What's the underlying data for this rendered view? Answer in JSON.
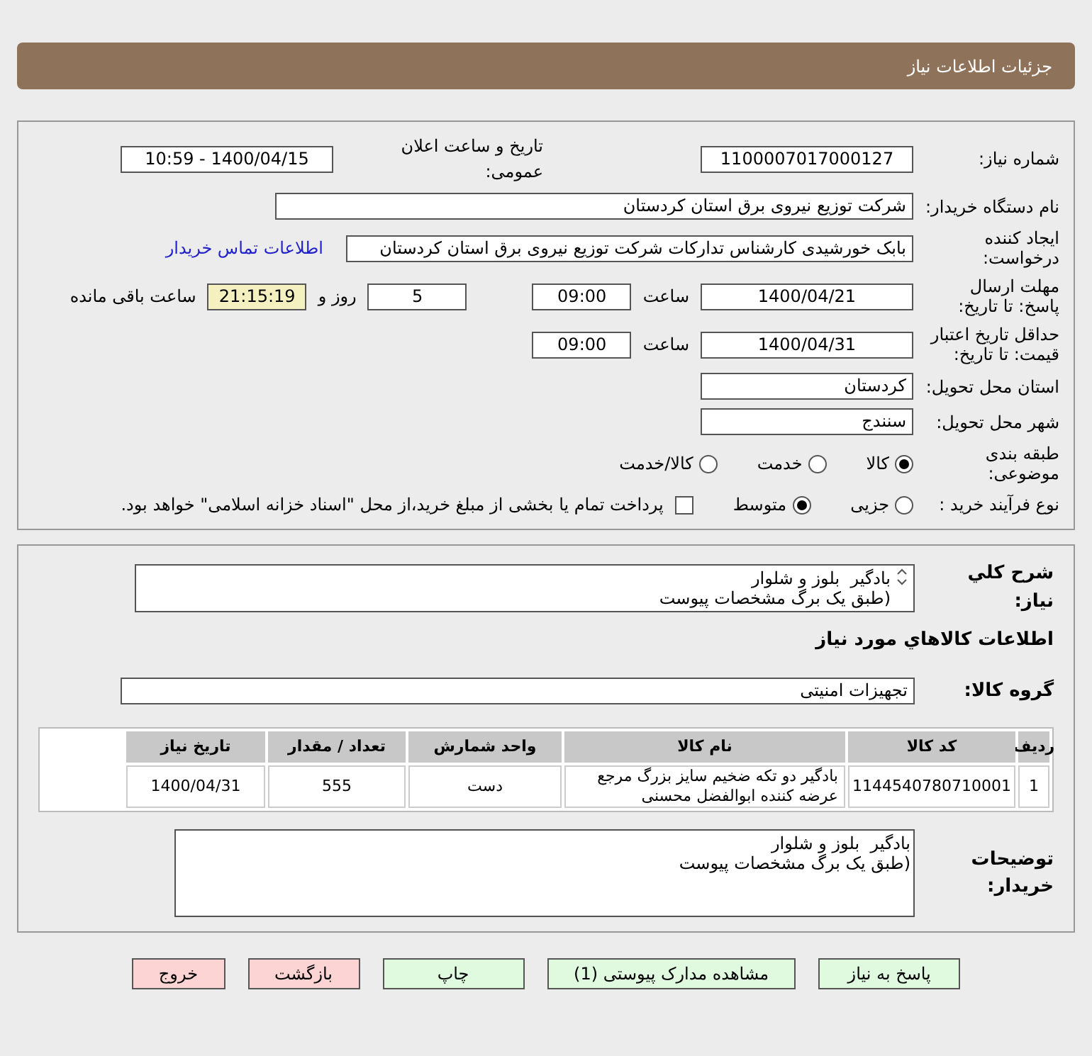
{
  "header": {
    "title": "جزئیات اطلاعات نیاز"
  },
  "need_number": {
    "label": "شماره نیاز:",
    "value": "1100007017000127"
  },
  "announce": {
    "label": "تاریخ و ساعت اعلان عمومی:",
    "value": "1400/04/15 - 10:59"
  },
  "buyer": {
    "label": "نام دستگاه خریدار:",
    "value": "شرکت توزیع نیروی برق استان کردستان"
  },
  "creator": {
    "label": "ایجاد کننده درخواست:",
    "value": "بابک خورشیدی کارشناس تدارکات شرکت توزیع نیروی برق استان کردستان",
    "link": "اطلاعات تماس خریدار"
  },
  "deadline": {
    "label": "مهلت ارسال پاسخ: تا تاریخ:",
    "date": "1400/04/21",
    "time_label": "ساعت",
    "time": "09:00",
    "days": "5",
    "days_label": "روز و",
    "countdown": "21:15:19",
    "remaining_label": "ساعت باقی مانده"
  },
  "validity": {
    "label": "حداقل تاریخ اعتبار قیمت: تا تاریخ:",
    "date": "1400/04/31",
    "time_label": "ساعت",
    "time": "09:00"
  },
  "province": {
    "label": "استان محل تحویل:",
    "value": "کردستان"
  },
  "city": {
    "label": "شهر محل تحویل:",
    "value": "سنندج"
  },
  "category": {
    "label": "طبقه بندی موضوعی:",
    "options": [
      {
        "label": "کالا",
        "selected": true
      },
      {
        "label": "خدمت",
        "selected": false
      },
      {
        "label": "کالا/خدمت",
        "selected": false
      }
    ]
  },
  "purchase_type": {
    "label": "نوع فرآیند خرید :",
    "options": [
      {
        "label": "جزیی",
        "selected": false
      },
      {
        "label": "متوسط",
        "selected": true
      }
    ],
    "payment": {
      "label": "پرداخت تمام یا بخشی از مبلغ خرید،از محل \"اسناد خزانه اسلامی\" خواهد بود.",
      "checked": false
    }
  },
  "description": {
    "label": "شرح کلي نياز:",
    "lines": [
      "بادگیر  بلوز و شلوار",
      "(طبق یک برگ مشخصات پیوست"
    ]
  },
  "goods_heading": "اطلاعات کالاهاي مورد نياز",
  "goods_group": {
    "label": "گروه کالا:",
    "value": "تجهیزات امنیتی"
  },
  "table": {
    "columns": [
      "ردیف",
      "کد کالا",
      "نام کالا",
      "واحد شمارش",
      "تعداد / مقدار",
      "تاریخ نیاز"
    ],
    "rows": [
      [
        "1",
        "1144540780710001",
        "بادگیر دو تکه ضخیم سایز بزرگ مرجع عرضه کننده ابوالفضل محسنی",
        "دست",
        "555",
        "1400/04/31"
      ]
    ]
  },
  "buyer_notes": {
    "label": "توضیحات خریدار:",
    "lines": [
      "بادگیر  بلوز و شلوار",
      "(طبق یک برگ مشخصات پیوست"
    ]
  },
  "buttons": [
    {
      "label": "پاسخ به نیاز",
      "kind": "normal"
    },
    {
      "label": "مشاهده مدارک پیوستی (1)",
      "kind": "normal"
    },
    {
      "label": "چاپ",
      "kind": "normal"
    },
    {
      "label": "بازگشت",
      "kind": "danger"
    },
    {
      "label": "خروج",
      "kind": "danger"
    }
  ]
}
